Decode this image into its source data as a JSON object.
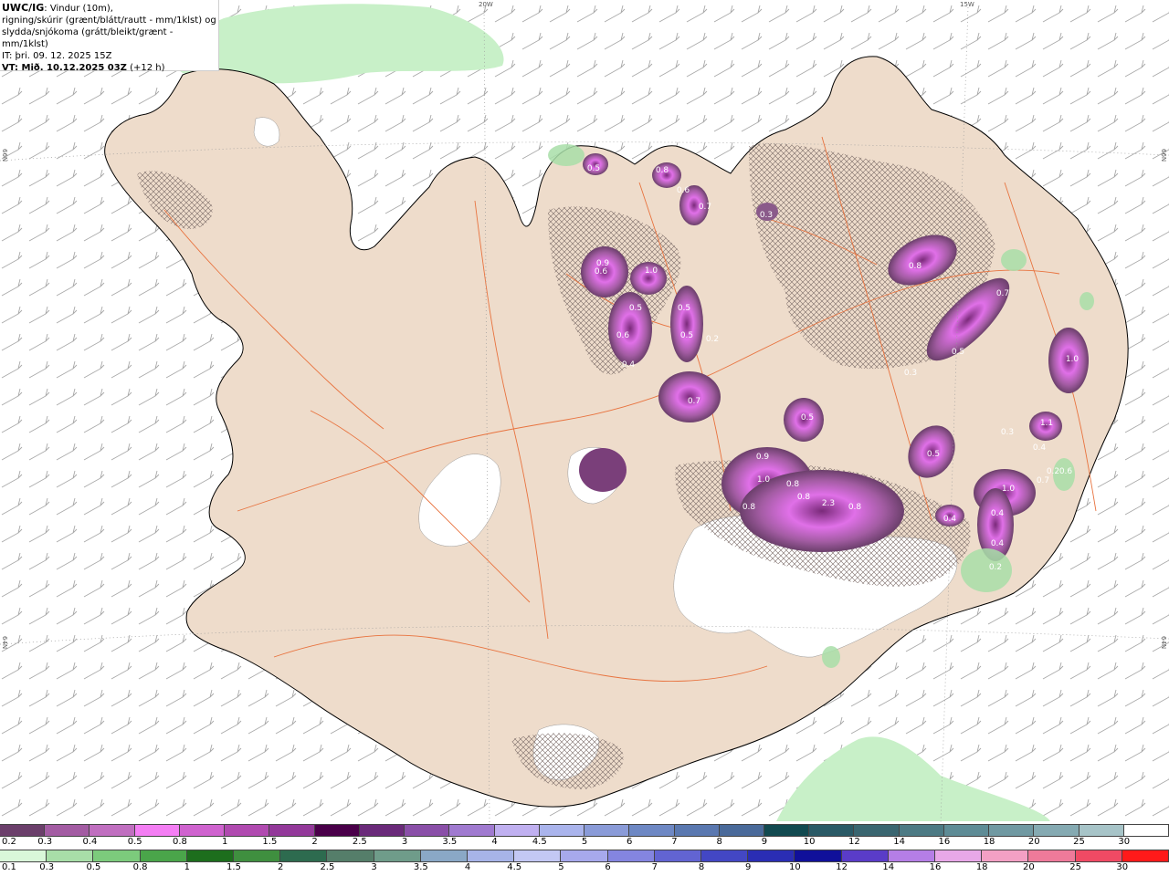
{
  "title": {
    "model": "UWC/IG",
    "description_1": ": Vindur (10m),",
    "description_2": "rigning/skúrir (grænt/blátt/rautt - mm/1klst) og",
    "description_3": "slydda/snjókoma (grátt/bleikt/grænt - mm/1klst)",
    "initial_time": "IT: þri. 09. 12. 2025 15Z",
    "valid_time_prefix": "VT: Mið. 10.12.2025 03Z",
    "valid_time_offset": " (+12 h)"
  },
  "grid_labels": {
    "lon_20w": "20W",
    "lon_15w": "15W",
    "lat_66n_left": "66N",
    "lat_66n_right": "66N",
    "lat_64n_left": "64N",
    "lat_64n_right": "64N"
  },
  "precip_labels": [
    "0.5",
    "0.8",
    "0.6",
    "0.7",
    "0.3",
    "0.6",
    "0.9",
    "1.0",
    "0.5",
    "0.6",
    "0.4",
    "0.5",
    "0.5",
    "0.2",
    "0.7",
    "0.8",
    "0.7",
    "0.5",
    "0.3",
    "0.4",
    "0.3",
    "0.9",
    "1.0",
    "0.8",
    "0.8",
    "0.8",
    "2.3",
    "0.8",
    "0.4",
    "0.5",
    "0.2",
    "0.4",
    "1.0",
    "1.1",
    "0.6",
    "1.0",
    "0.7",
    "0.4",
    "0.2",
    "0.5"
  ],
  "legend_snow": {
    "labels": [
      "0.2",
      "0.3",
      "0.4",
      "0.5",
      "0.8",
      "1",
      "1.5",
      "2",
      "2.5",
      "3",
      "3.5",
      "4",
      "4.5",
      "5",
      "6",
      "7",
      "8",
      "9",
      "10",
      "12",
      "14",
      "16",
      "18",
      "20",
      "25",
      "30"
    ],
    "colors": [
      "#6b3f6b",
      "#a35ca3",
      "#c06fc0",
      "#f47ef4",
      "#cf63cf",
      "#b04ab0",
      "#93399a",
      "#4a004a",
      "#6a2a7a",
      "#8a4fa8",
      "#a07ad0",
      "#c0b0f0",
      "#aab4ec",
      "#8a9bd8",
      "#6e88c4",
      "#5a78b0",
      "#4a6a9a",
      "#124a50",
      "#2a5a66",
      "#3a6670",
      "#4c7a84",
      "#5e8c96",
      "#7099a2",
      "#85aab2",
      "#a7c4c8",
      "#ffffff"
    ]
  },
  "legend_rain": {
    "labels": [
      "0.1",
      "0.3",
      "0.5",
      "0.8",
      "1",
      "1.5",
      "2",
      "2.5",
      "3",
      "3.5",
      "4",
      "4.5",
      "5",
      "6",
      "7",
      "8",
      "9",
      "10",
      "12",
      "14",
      "16",
      "18",
      "20",
      "25",
      "30"
    ],
    "colors": [
      "#d9f7d9",
      "#a8dea8",
      "#7ccb7c",
      "#4aa54a",
      "#1d6e1d",
      "#3f8f3f",
      "#2d6b4f",
      "#557e6a",
      "#6f9c8a",
      "#8aa8c6",
      "#a7b4e8",
      "#c3c8f4",
      "#a7a9ec",
      "#8485e0",
      "#6264d2",
      "#4347c4",
      "#2a2db4",
      "#10109a",
      "#5a3cc8",
      "#b57ee6",
      "#e8a8e8",
      "#f3a0c4",
      "#ee7a9a",
      "#f04a64",
      "#ff1a1a"
    ]
  },
  "colors": {
    "land": "#eedccb",
    "coast": "#000000",
    "roads": "#e8733f",
    "snow_hatch": "#7a6a66",
    "barb": "#a8a8a8",
    "rain_light": "#c8f0c8"
  }
}
